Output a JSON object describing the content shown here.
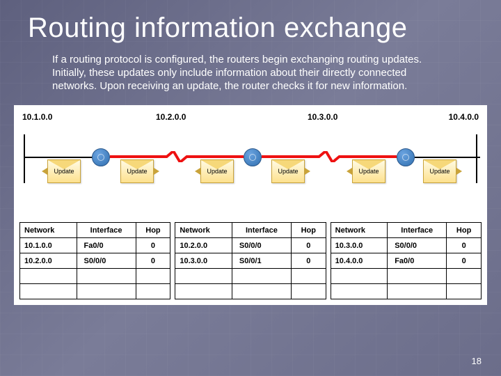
{
  "title": "Routing information exchange",
  "body": "If a routing protocol is configured, the routers begin exchanging routing updates. Initially, these updates only include information about their directly connected networks. Upon receiving an update, the router checks it for new information.",
  "networks": {
    "n1": "10.1.0.0",
    "n2": "10.2.0.0",
    "n3": "10.3.0.0",
    "n4": "10.4.0.0"
  },
  "update_label": "Update",
  "table_headers": {
    "net": "Network",
    "iface": "Interface",
    "hop": "Hop"
  },
  "tables": [
    [
      {
        "net": "10.1.0.0",
        "iface": "Fa0/0",
        "hop": "0"
      },
      {
        "net": "10.2.0.0",
        "iface": "S0/0/0",
        "hop": "0"
      }
    ],
    [
      {
        "net": "10.2.0.0",
        "iface": "S0/0/0",
        "hop": "0"
      },
      {
        "net": "10.3.0.0",
        "iface": "S0/0/1",
        "hop": "0"
      }
    ],
    [
      {
        "net": "10.3.0.0",
        "iface": "S0/0/0",
        "hop": "0"
      },
      {
        "net": "10.4.0.0",
        "iface": "Fa0/0",
        "hop": "0"
      }
    ]
  ],
  "slide_number": "18"
}
